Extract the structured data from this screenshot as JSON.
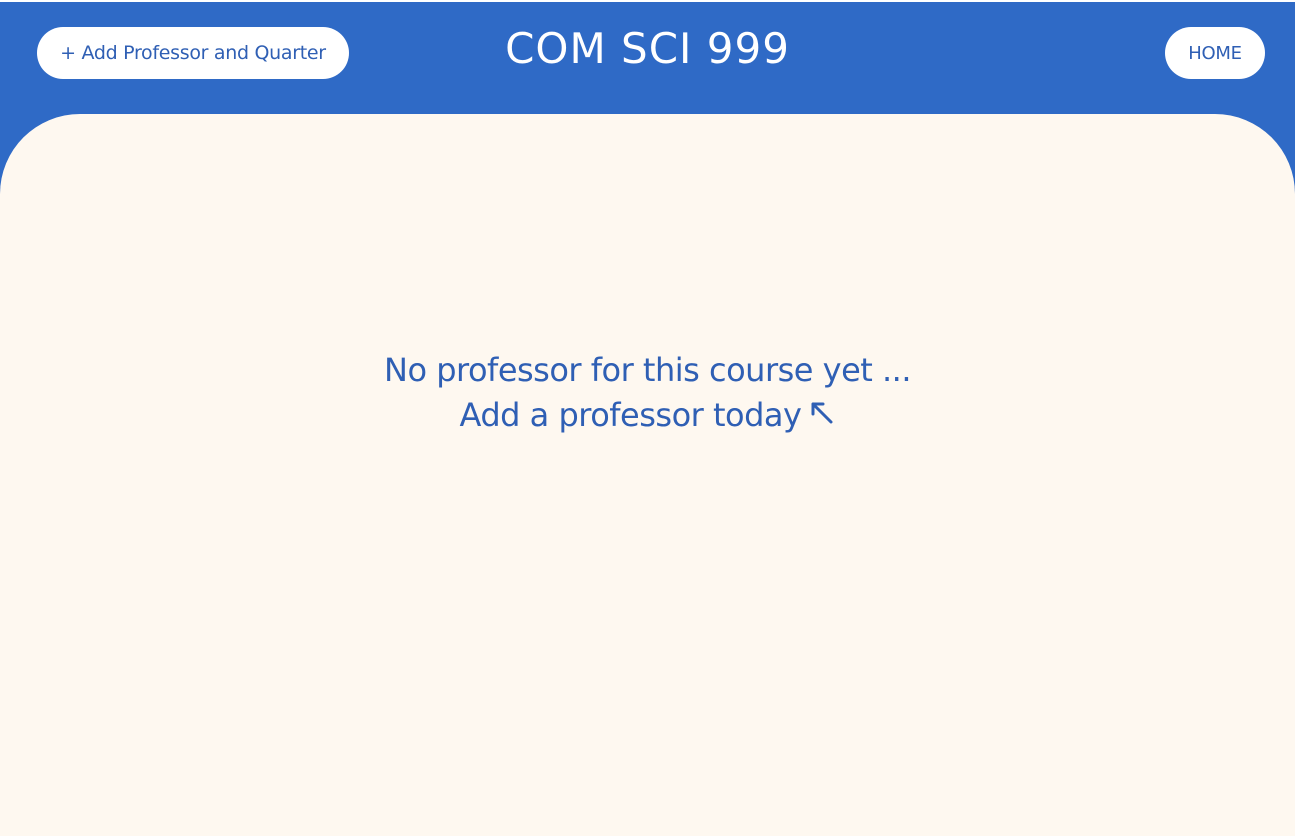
{
  "header": {
    "add_button_label": "+ Add Professor and Quarter",
    "course_title": "COM SCI 999",
    "home_button_label": "HOME"
  },
  "main": {
    "empty_line_1": "No professor for this course yet ...",
    "empty_line_2": "Add a professor today",
    "arrow_icon": "arrow-up-left-icon"
  },
  "colors": {
    "primary_blue": "#2f6ac6",
    "text_blue": "#2f5fb4",
    "panel_background": "#fef8f0",
    "button_background": "#ffffff"
  }
}
